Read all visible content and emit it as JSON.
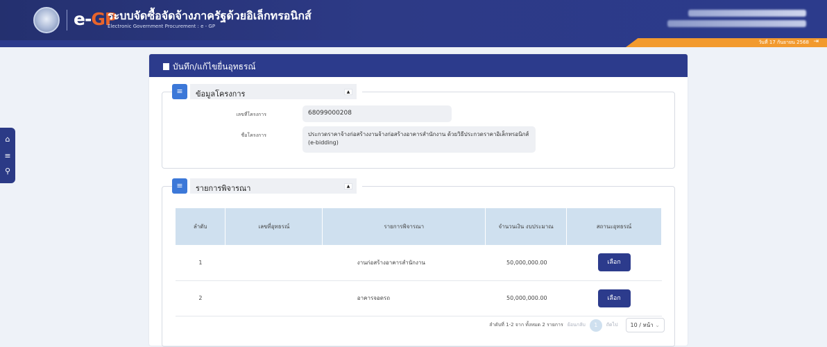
{
  "header": {
    "logo_e": "e-",
    "logo_gp": "GP",
    "title": "ระบบจัดซื้อจัดจ้างภาครัฐด้วยอิเล็กทรอนิกส์",
    "subtitle": "Electronic Government Procurement : e - GP",
    "date": "วันที่ 17 กันยายน 2568",
    "logout_icon": "logout-icon"
  },
  "sidenav": {
    "icons": [
      "home-icon",
      "menu-icon",
      "search-icon"
    ]
  },
  "panel": {
    "title": "บันทึก/แก้ไขยื่นอุทธรณ์"
  },
  "project_section": {
    "legend": "ข้อมูลโครงการ",
    "project_no_label": "เลขที่โครงการ",
    "project_no": "68099000208",
    "project_name_label": "ชื่อโครงการ",
    "project_name": "ประกวดราคาจ้างก่อสร้างงานจ้างก่อสร้างอาคารสำนักงาน ด้วยวิธีประกวดราคาอิเล็กทรอนิกส์ (e-bidding)"
  },
  "consider_section": {
    "legend": "รายการพิจารณา",
    "table": {
      "headers": [
        "ลำดับ",
        "เลขที่อุทธรณ์",
        "รายการพิจารณา",
        "จำนวนเงิน งบประมาณ",
        "สถานะอุทธรณ์"
      ],
      "rows": [
        {
          "no": "1",
          "appeal_no": "",
          "item": "งานก่อสร้างอาคารสำนักงาน",
          "amount": "50,000,000.00",
          "action": "เลือก"
        },
        {
          "no": "2",
          "appeal_no": "",
          "item": "อาคารจอดรถ",
          "amount": "50,000,000.00",
          "action": "เลือก"
        }
      ]
    },
    "pager": {
      "summary": "ลำดับที่ 1-2 จาก ทั้งหมด 2 รายการ",
      "prev": "ย้อนกลับ",
      "current": "1",
      "next": "ถัดไป",
      "page_size": "10 / หน้า"
    }
  }
}
